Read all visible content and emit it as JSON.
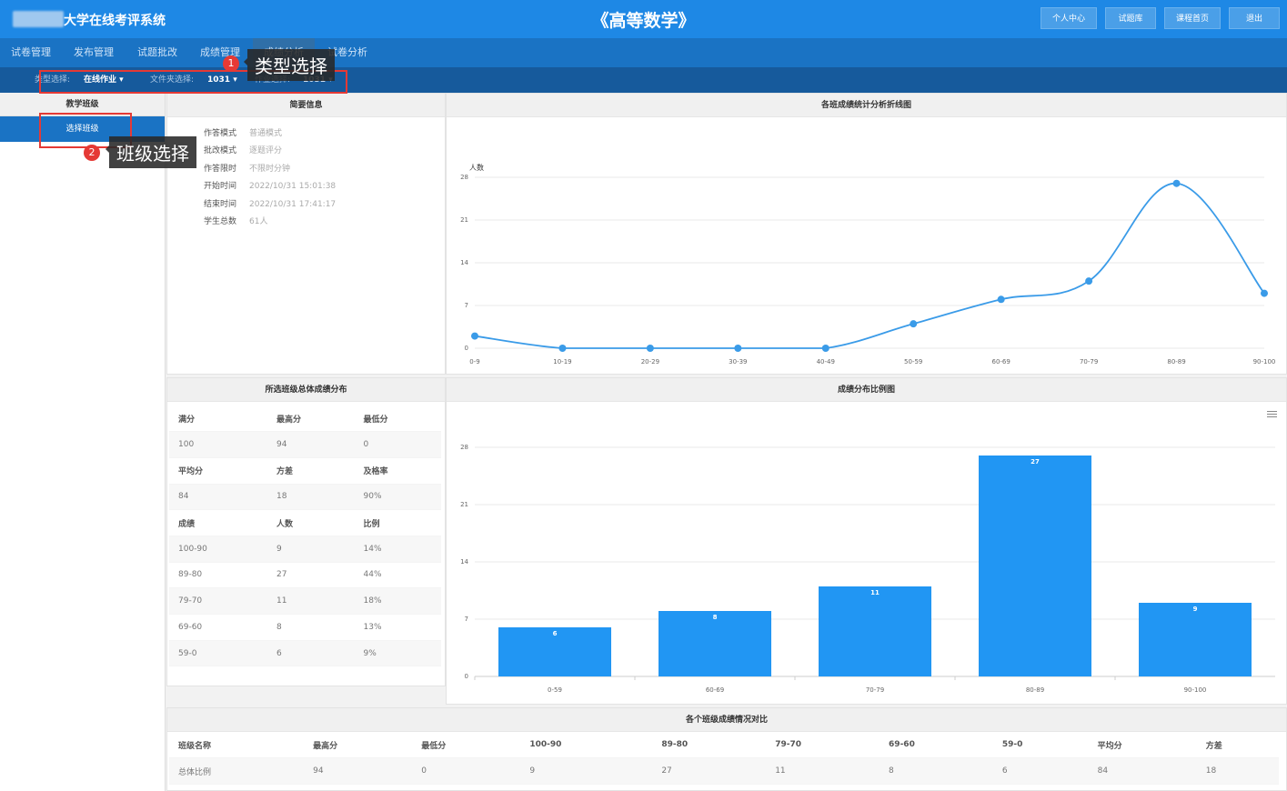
{
  "header": {
    "system_name": "大学在线考评系统",
    "course_title": "《高等数学》",
    "buttons": [
      "个人中心",
      "试题库",
      "课程首页",
      "退出"
    ]
  },
  "nav": {
    "items": [
      "试卷管理",
      "发布管理",
      "试题批改",
      "成绩管理",
      "成绩分析",
      "试卷分析"
    ],
    "active_index": 4
  },
  "filters": {
    "type_label": "类型选择:",
    "type_value": "在线作业",
    "folder_label": "文件夹选择:",
    "folder_value": "1031",
    "homework_label": "作业选择:",
    "homework_value": "1031"
  },
  "callouts": [
    {
      "number": "1",
      "text": "类型选择"
    },
    {
      "number": "2",
      "text": "班级选择"
    }
  ],
  "sidebar": {
    "heading": "教学班级",
    "item": "选择班级"
  },
  "summary": {
    "heading": "简要信息",
    "rows": [
      {
        "label": "作答模式",
        "value": "普通模式"
      },
      {
        "label": "批改模式",
        "value": "逐题评分"
      },
      {
        "label": "作答限时",
        "value": "不限时分钟"
      },
      {
        "label": "开始时间",
        "value": "2022/10/31 15:01:38"
      },
      {
        "label": "结束时间",
        "value": "2022/10/31 17:41:17"
      },
      {
        "label": "学生总数",
        "value": "61人"
      }
    ]
  },
  "distribution": {
    "heading": "所选班级总体成绩分布",
    "rows": [
      [
        "满分",
        "最高分",
        "最低分"
      ],
      [
        "100",
        "94",
        "0"
      ],
      [
        "平均分",
        "方差",
        "及格率"
      ],
      [
        "84",
        "18",
        "90%"
      ],
      [
        "成绩",
        "人数",
        "比例"
      ],
      [
        "100-90",
        "9",
        "14%"
      ],
      [
        "89-80",
        "27",
        "44%"
      ],
      [
        "79-70",
        "11",
        "18%"
      ],
      [
        "69-60",
        "8",
        "13%"
      ],
      [
        "59-0",
        "6",
        "9%"
      ]
    ],
    "header_rows": [
      0,
      2,
      4
    ]
  },
  "comparison": {
    "heading": "各个班级成绩情况对比",
    "headers": [
      "班级名称",
      "最高分",
      "最低分",
      "100-90",
      "89-80",
      "79-70",
      "69-60",
      "59-0",
      "平均分",
      "方差"
    ],
    "row": [
      "总体比例",
      "94",
      "0",
      "9",
      "27",
      "11",
      "8",
      "6",
      "84",
      "18"
    ]
  },
  "chart_data": [
    {
      "type": "line",
      "title": "各班成绩统计分析折线图",
      "ylabel": "人数",
      "categories": [
        "0-9",
        "10-19",
        "20-29",
        "30-39",
        "40-49",
        "50-59",
        "60-69",
        "70-79",
        "80-89",
        "90-100"
      ],
      "values": [
        2,
        0,
        0,
        0,
        0,
        4,
        8,
        11,
        27,
        9
      ],
      "yticks": [
        0,
        7,
        14,
        21,
        28
      ],
      "ylim": [
        0,
        28
      ],
      "color": "#3a9be8"
    },
    {
      "type": "bar",
      "title": "成绩分布比例图",
      "categories": [
        "0-59",
        "60-69",
        "70-79",
        "80-89",
        "90-100"
      ],
      "values": [
        6,
        8,
        11,
        27,
        9
      ],
      "yticks": [
        0,
        7,
        14,
        21,
        28
      ],
      "ylim": [
        0,
        28
      ],
      "color": "#2196f3"
    }
  ]
}
